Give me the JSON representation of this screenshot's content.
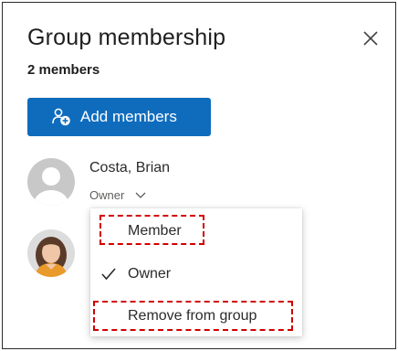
{
  "panel": {
    "title": "Group membership",
    "member_count": "2 members",
    "add_button_label": "Add members"
  },
  "members": [
    {
      "name": "Costa, Brian",
      "role": "Owner"
    },
    {
      "name": ""
    }
  ],
  "role_menu": {
    "items": [
      {
        "label": "Member",
        "checked": false
      },
      {
        "label": "Owner",
        "checked": true
      },
      {
        "label": "Remove from group",
        "checked": false
      }
    ]
  },
  "colors": {
    "accent": "#0f6cbd",
    "highlight": "#d10000"
  },
  "icons": {
    "close": "close-icon",
    "add_people": "people-add-icon",
    "chevron": "chevron-down-icon",
    "check": "checkmark-icon"
  }
}
